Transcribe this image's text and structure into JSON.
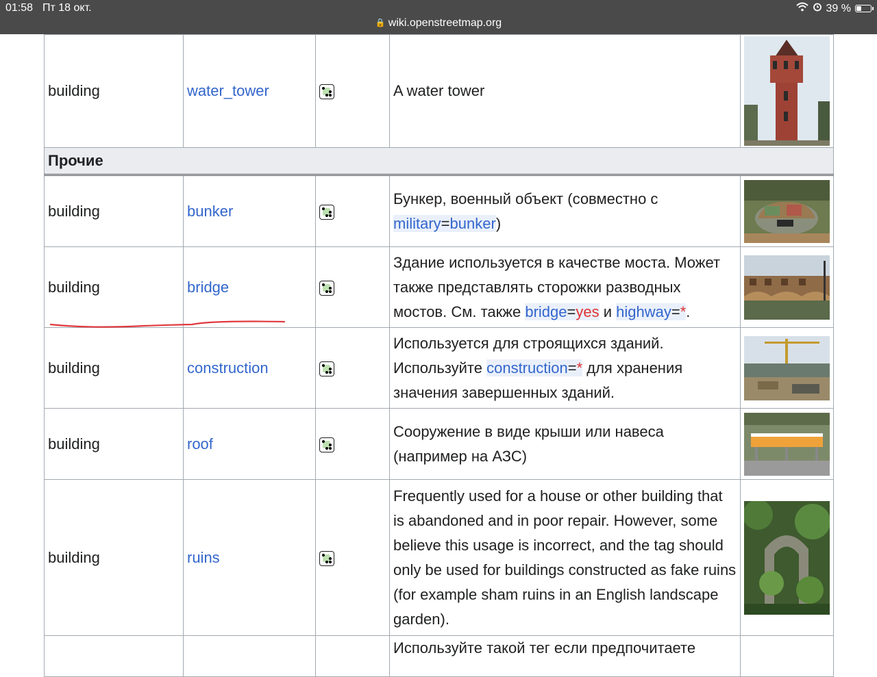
{
  "status_bar": {
    "time": "01:58",
    "date": "Пт 18 окт.",
    "url": "wiki.openstreetmap.org",
    "battery": "39 %",
    "battery_level": 0.39
  },
  "table": {
    "rows": [
      {
        "key": "building",
        "value": "water_tower",
        "description": [
          "A water tower"
        ],
        "image": "water-tower-photo"
      },
      {
        "section": "Прочие"
      },
      {
        "key": "building",
        "value": "bunker",
        "description_parts": [
          "Бункер, военный объект (совместно с ",
          "military",
          "=",
          "bunker",
          ")"
        ],
        "image": "bunker-photo"
      },
      {
        "key": "building",
        "value": "bridge",
        "description_parts": [
          "Здание используется в качестве моста. Может также представлять сторожки разводных мостов. См. также ",
          "bridge",
          "=",
          "yes",
          " и ",
          "highway",
          "=",
          "*",
          "."
        ],
        "image": "bridge-photo"
      },
      {
        "key": "building",
        "value": "construction",
        "description_parts": [
          "Используется для строящихся зданий. Используйте ",
          "construction",
          "=",
          "*",
          " для хранения значения завершенных зданий."
        ],
        "image": "construction-photo"
      },
      {
        "key": "building",
        "value": "roof",
        "description": [
          "Сооружение в виде крыши или навеса (например на АЗС)"
        ],
        "image": "roof-photo"
      },
      {
        "key": "building",
        "value": "ruins",
        "description": [
          "Frequently used for a house or other building that is abandoned and in poor repair. However, some believe this usage is incorrect, and the tag should only be used for buildings constructed as fake ruins (for example sham ruins in an English landscape garden)."
        ],
        "image": "ruins-photo"
      },
      {
        "partial_description": "Используйте такой тег если предпочитаете"
      }
    ]
  },
  "colors": {
    "link": "#3366cc",
    "red_value": "#dd3333",
    "section_bg": "#eaecf0",
    "border": "#a2a9b1",
    "annotation_underline": "#e0393e"
  }
}
